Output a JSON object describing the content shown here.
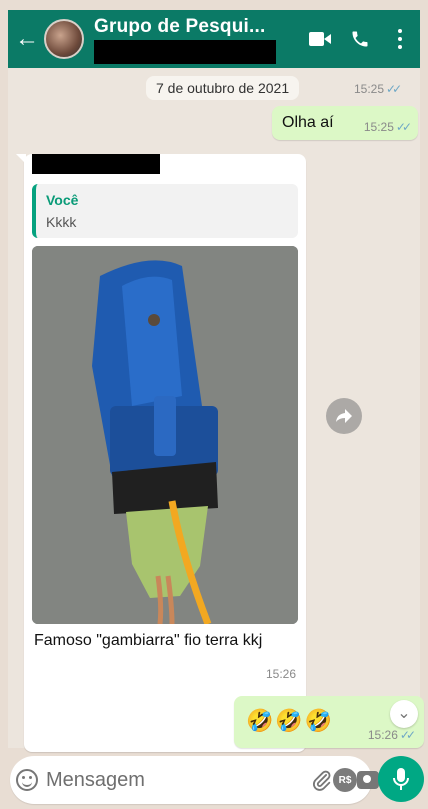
{
  "header": {
    "back_label": "←",
    "title": "Grupo de Pesqui...",
    "color": "#0b7a66"
  },
  "chat": {
    "date": "7 de outubro de 2021",
    "date_time": "15:25",
    "messages": [
      {
        "type": "outgoing",
        "text": "Olha aí",
        "time": "15:25"
      },
      {
        "type": "incoming",
        "quote": {
          "name": "Você",
          "text": "Kkkk"
        },
        "caption": "Famoso \"gambiarra\" fio terra kkj",
        "time": "15:26"
      },
      {
        "type": "outgoing",
        "text": "🤣🤣🤣",
        "time": "15:26"
      }
    ]
  },
  "composer": {
    "placeholder": "Mensagem",
    "rs_label": "R$"
  },
  "icons": {
    "video": "video-call-icon",
    "call": "phone-icon",
    "menu": "more-vert-icon",
    "emoji": "emoji-icon",
    "attach": "paperclip-icon",
    "payment": "payment-icon",
    "camera": "camera-icon",
    "mic": "mic-icon",
    "forward": "forward-icon",
    "scroll": "scroll-down-icon"
  },
  "colors": {
    "outgoing_bubble": "#dcf8c6",
    "accent": "#00a884",
    "quote_bar": "#06a27f"
  }
}
